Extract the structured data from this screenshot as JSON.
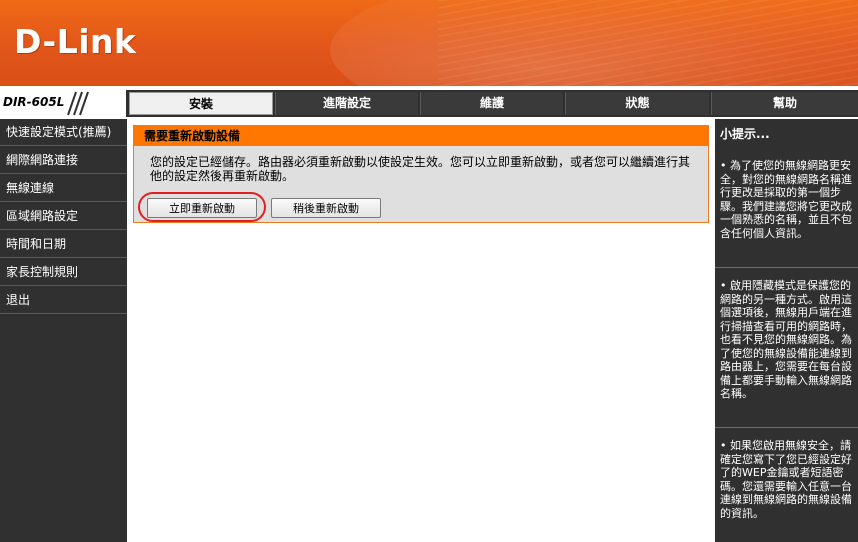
{
  "header": {
    "logo_text": "D-Link",
    "model": "DIR-605L"
  },
  "nav": {
    "tabs": [
      {
        "label": "安裝"
      },
      {
        "label": "進階設定"
      },
      {
        "label": "維護"
      },
      {
        "label": "狀態"
      },
      {
        "label": "幫助"
      }
    ],
    "active_tab": "安裝"
  },
  "sidebar": {
    "items": [
      {
        "label": "快速設定模式(推薦)"
      },
      {
        "label": "網際網路連接"
      },
      {
        "label": "無線連線"
      },
      {
        "label": "區域網路設定"
      },
      {
        "label": "時間和日期"
      },
      {
        "label": "家長控制規則"
      },
      {
        "label": "退出"
      }
    ]
  },
  "reboot": {
    "title": "需要重新啟動設備",
    "message": "您的設定已經儲存。路由器必須重新啟動以使設定生效。您可以立即重新啟動，或者您可以繼續進行其他的設定然後再重新啟動。",
    "reboot_now_label": "立即重新啟動",
    "reboot_later_label": "稍後重新啟動"
  },
  "tips": {
    "title": "小提示...",
    "items": [
      "• 為了使您的無線網路更安全，對您的無線網路名稱進行更改是採取的第一個步驟。我們建議您將它更改成一個熟悉的名稱，並且不包含任何個人資訊。",
      "• 啟用隱藏模式是保護您的網路的另一種方式。啟用這個選項後，無線用戶端在進行掃描查看可用的網路時，也看不見您的無線網路。為了使您的無線設備能連線到路由器上，您需要在每台設備上都要手動輸入無線網路名稱。",
      "• 如果您啟用無線安全，請確定您寫下了您已經設定好了的WEP金鑰或者短語密碼。您還需要輸入任意一台連線到無線網路的無線設備的資訊。"
    ]
  },
  "colors": {
    "header_orange": "#e2561a",
    "nav_dark": "#303030",
    "title_orange": "#ff7700",
    "box_gray": "#dfdfdf",
    "highlight_red": "#e02020"
  }
}
